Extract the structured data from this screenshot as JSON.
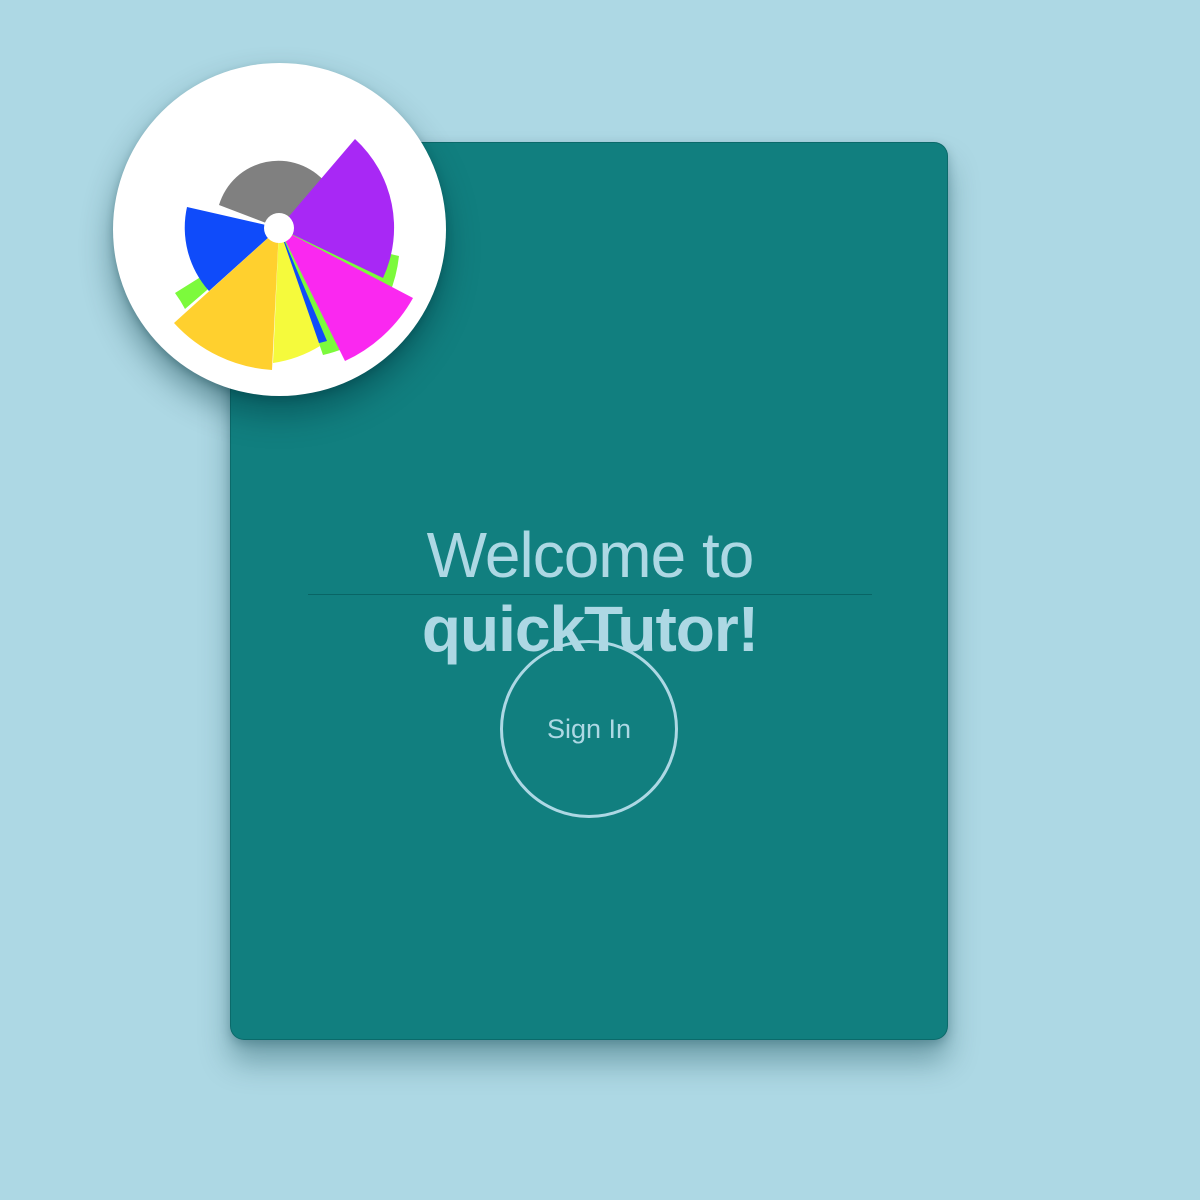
{
  "welcome": {
    "line1": "Welcome to",
    "line2": "quickTutor!"
  },
  "signin": {
    "label": "Sign In"
  },
  "logo": {
    "icon": "quicktutor-logo-icon",
    "colors": {
      "gray": "#808080",
      "purple": "#a828f5",
      "blue": "#0f4bfa",
      "green": "#7cfa3c",
      "yellow": "#ffd02e",
      "lemon": "#f5fa3c",
      "magenta": "#fa28f0",
      "hub": "#ffffff"
    }
  },
  "colors": {
    "background": "#add8e4",
    "card": "#117f7f",
    "text": "#add8e4"
  }
}
